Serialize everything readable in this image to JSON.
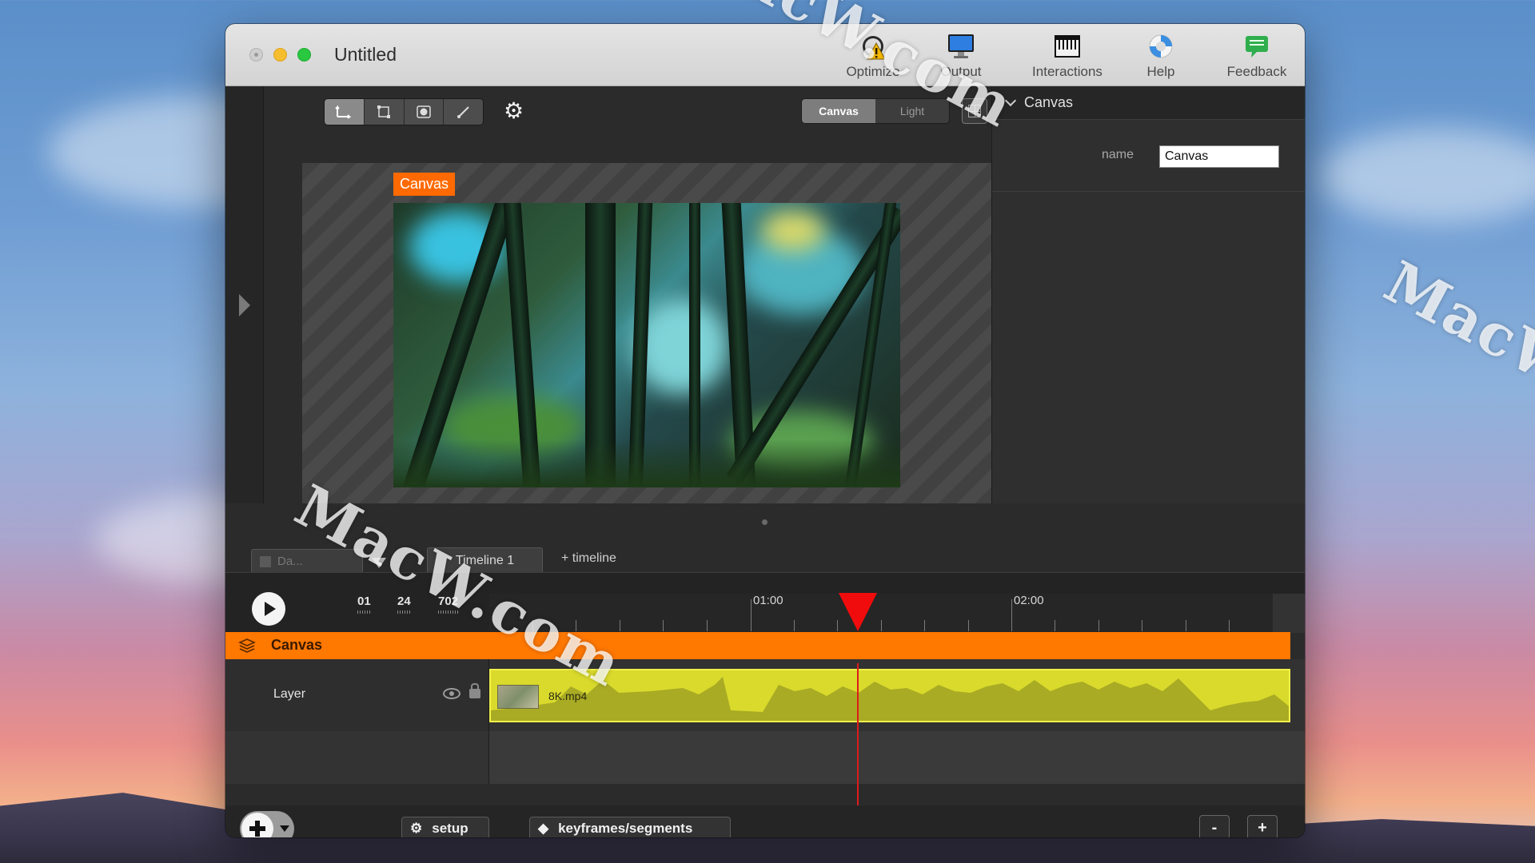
{
  "window": {
    "title": "Untitled"
  },
  "toolbar": {
    "items": [
      {
        "label": "Optimize",
        "icon": "optimize-warning-icon"
      },
      {
        "label": "Output",
        "icon": "monitor-icon"
      },
      {
        "label": "Interactions",
        "icon": "piano-keys-icon"
      },
      {
        "label": "Help",
        "icon": "lifebuoy-icon"
      },
      {
        "label": "Feedback",
        "icon": "chat-bubble-icon"
      }
    ]
  },
  "editor": {
    "tools": [
      "move-tool-icon",
      "crop-tool-icon",
      "mask-tool-icon",
      "brush-tool-icon"
    ],
    "view_toggle": {
      "options": [
        "Canvas",
        "Light"
      ],
      "selected": "Canvas"
    },
    "canvas_tag": "Canvas"
  },
  "inspector": {
    "section_title": "Canvas",
    "name_label": "name",
    "name_value": "Canvas"
  },
  "timeline": {
    "dropdown_value": "Da...",
    "tabs": [
      "Timeline 1"
    ],
    "add_timeline_label": "+ timeline",
    "counters": [
      "01",
      "24",
      "702"
    ],
    "ruler_labels": [
      "01:00",
      "02:00"
    ],
    "playhead_time": "01:24",
    "tracks": [
      {
        "name": "Canvas",
        "type": "group",
        "color": "#ff7800"
      },
      {
        "name": "Layer",
        "clip": "8K.mp4",
        "clip_color": "#d9da2c"
      }
    ]
  },
  "bottom_bar": {
    "setup_label": "setup",
    "keyframes_label": "keyframes/segments",
    "zoom_out_label": "-",
    "zoom_in_label": "+"
  },
  "watermarks": [
    "MacW.com",
    "MacW.com",
    "MacW.c"
  ]
}
